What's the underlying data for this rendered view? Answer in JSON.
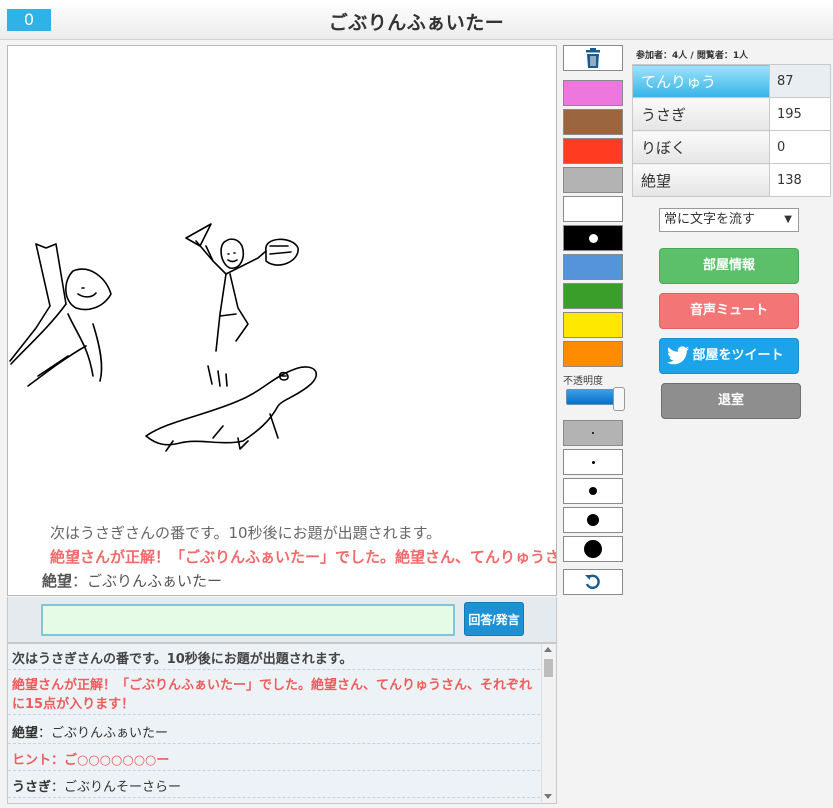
{
  "header": {
    "timer": "0",
    "title": "ごぶりんふぁいたー"
  },
  "canvas": {
    "flow_messages": [
      "次はうさぎさんの番です。10秒後にお題が出題されます。",
      "絶望さんが正解！「ごぶりんふぁいたー」でした。絶望さん、てんりゅうさん、それぞれに15点が入ります！"
    ],
    "flow_chat": {
      "name": "絶望",
      "text": "：ごぶりんふぁいたー"
    }
  },
  "answer": {
    "value": "",
    "button_label": "回答/発言"
  },
  "chat_log": [
    {
      "type": "sys",
      "text": "次はうさぎさんの番です。10秒後にお題が出題されます。"
    },
    {
      "type": "red",
      "text": "絶望さんが正解！「ごぶりんふぁいたー」でした。絶望さん、てんりゅうさん、それぞれに15点が入ります！"
    },
    {
      "type": "chat",
      "name": "絶望",
      "text": "：ごぶりんふぁいたー"
    },
    {
      "type": "red",
      "text": "ヒント：ご○○○○○○○ー"
    },
    {
      "type": "chat",
      "name": "うさぎ",
      "text": "：ごぶりんそーさらー"
    }
  ],
  "tools": {
    "colors": [
      "#ee77dd",
      "#9b6540",
      "#ff3b22",
      "#b3b3b3",
      "#ffffff",
      "#000000",
      "#5593da",
      "#3a9f2a",
      "#ffe800",
      "#ff8c00"
    ],
    "opacity_label": "不透明度",
    "opacity_value": 1.0,
    "pen_sizes": [
      2,
      3,
      8,
      12,
      18
    ]
  },
  "room": {
    "participants": "参加者：4人 / 閲覧者：1人",
    "players": [
      {
        "name": "てんりゅう",
        "score": "87",
        "active": true
      },
      {
        "name": "うさぎ",
        "score": "195",
        "active": false
      },
      {
        "name": "りぼく",
        "score": "0",
        "active": false
      },
      {
        "name": "絶望",
        "score": "138",
        "active": false
      }
    ],
    "flow_mode": "常に文字を流す",
    "buttons": {
      "room_info": "部屋情報",
      "mute": "音声ミュート",
      "tweet": "部屋をツイート",
      "exit": "退室"
    }
  }
}
